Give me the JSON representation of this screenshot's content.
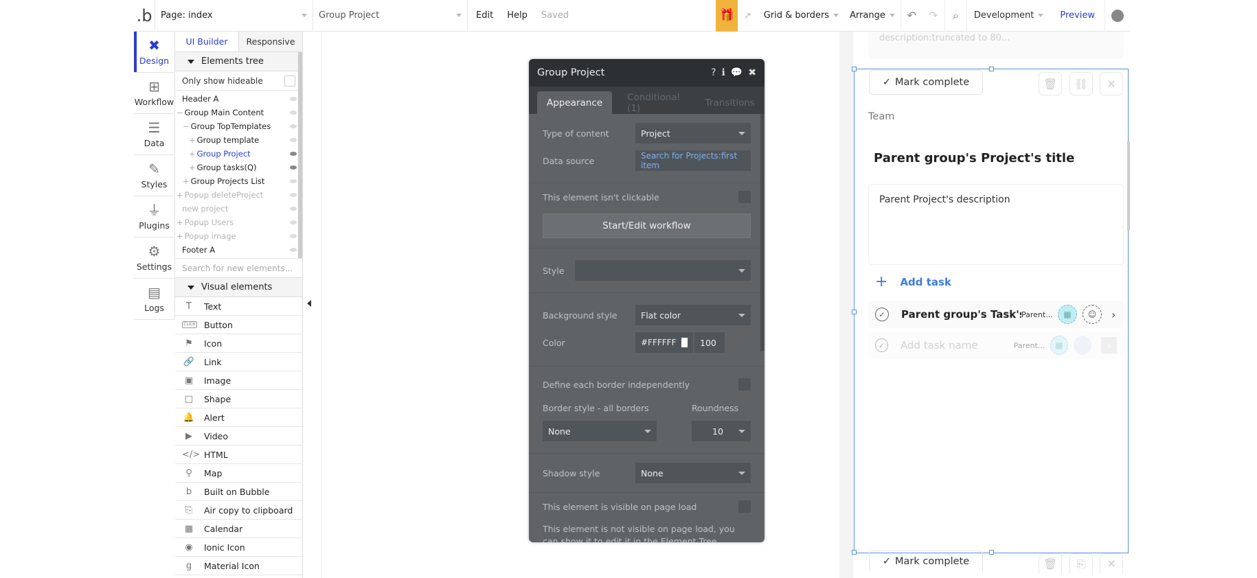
{
  "topbar": {
    "logo": ".b",
    "page_select": "Page: index",
    "element_select": "Group Project",
    "menu": {
      "edit": "Edit",
      "help": "Help",
      "status": "Saved"
    },
    "gift_icon": "gift-icon",
    "grid_borders": "Grid & borders",
    "arrange": "Arrange",
    "environment": "Development",
    "preview": "Preview"
  },
  "rail": {
    "items": [
      {
        "label": "Design",
        "icon": "design-icon",
        "active": true
      },
      {
        "label": "Workflow",
        "icon": "workflow-icon"
      },
      {
        "label": "Data",
        "icon": "database-icon"
      },
      {
        "label": "Styles",
        "icon": "brush-icon"
      },
      {
        "label": "Plugins",
        "icon": "plug-icon"
      },
      {
        "label": "Settings",
        "icon": "gear-icon"
      },
      {
        "label": "Logs",
        "icon": "document-icon"
      }
    ]
  },
  "left_panel": {
    "tabs": {
      "ui_builder": "UI Builder",
      "responsive": "Responsive"
    },
    "elements_tree_label": "Elements tree",
    "only_hideable_label": "Only show hideable",
    "tree": [
      {
        "label": "Header A",
        "prefix": "",
        "indent": 0
      },
      {
        "label": "Group Main Content",
        "prefix": "−",
        "indent": 0
      },
      {
        "label": "Group TopTemplates",
        "prefix": "−",
        "indent": 1
      },
      {
        "label": "Group template",
        "prefix": "+",
        "indent": 2
      },
      {
        "label": "Group Project",
        "prefix": "+",
        "indent": 2,
        "selected": true
      },
      {
        "label": "Group tasks(Q)",
        "prefix": "+",
        "indent": 2
      },
      {
        "label": "Group Projects List",
        "prefix": "+",
        "indent": 1
      },
      {
        "label": "Popup deleteProject",
        "prefix": "+",
        "indent": 0,
        "hidden": true
      },
      {
        "label": "new project",
        "prefix": "",
        "indent": 0,
        "hidden": true
      },
      {
        "label": "Popup Users",
        "prefix": "+",
        "indent": 0,
        "hidden": true
      },
      {
        "label": "Popup image",
        "prefix": "+",
        "indent": 0,
        "hidden": true
      },
      {
        "label": "Footer A",
        "prefix": "",
        "indent": 0
      }
    ],
    "search_placeholder": "Search for new elements...",
    "visual_elements_label": "Visual elements",
    "visual_elements": [
      {
        "label": "Text",
        "icon": "T"
      },
      {
        "label": "Button",
        "icon": "CLICK"
      },
      {
        "label": "Icon",
        "icon": "⚑"
      },
      {
        "label": "Link",
        "icon": "🔗"
      },
      {
        "label": "Image",
        "icon": "▣"
      },
      {
        "label": "Shape",
        "icon": "□"
      },
      {
        "label": "Alert",
        "icon": "🔔"
      },
      {
        "label": "Video",
        "icon": "▶"
      },
      {
        "label": "HTML",
        "icon": "</>"
      },
      {
        "label": "Map",
        "icon": "⚲"
      },
      {
        "label": "Built on Bubble",
        "icon": "b"
      },
      {
        "label": "Air copy to clipboard",
        "icon": "⎘"
      },
      {
        "label": "Calendar",
        "icon": "▦"
      },
      {
        "label": "Ionic Icon",
        "icon": "◉"
      },
      {
        "label": "Material Icon",
        "icon": "g"
      }
    ]
  },
  "property_editor": {
    "title": "Group Project",
    "tabs": {
      "appearance": "Appearance",
      "conditional": "Conditional (1)",
      "transitions": "Transitions"
    },
    "type_of_content_label": "Type of content",
    "type_of_content_value": "Project",
    "data_source_label": "Data source",
    "data_source_value": "Search for Projects:first item",
    "not_clickable_label": "This element isn't clickable",
    "workflow_button": "Start/Edit workflow",
    "style_label": "Style",
    "style_value": "",
    "background_style_label": "Background style",
    "background_style_value": "Flat color",
    "color_label": "Color",
    "color_value": "#FFFFFF",
    "color_opacity": "100",
    "define_borders_label": "Define each border independently",
    "border_style_label": "Border style - all borders",
    "border_style_value": "None",
    "roundness_label": "Roundness",
    "roundness_value": "10",
    "shadow_style_label": "Shadow style",
    "shadow_style_value": "None",
    "visible_on_load_label": "This element is visible on page load",
    "visible_note": "This element is not visible on page load, you can show it to edit it in the Element Tree."
  },
  "preview": {
    "top_text": "description:truncated to 80...",
    "mark_complete": "Mark complete",
    "team_label": "Team",
    "project_title": "Parent group's Project's title",
    "project_description": "Parent Project's description",
    "add_task": "Add task",
    "tasks": [
      {
        "name": "Parent group's Task's",
        "sub": "Parent..."
      },
      {
        "name": "Add task name",
        "sub": "Parent...",
        "placeholder": true
      }
    ],
    "accent_color": "#3d7be0"
  }
}
